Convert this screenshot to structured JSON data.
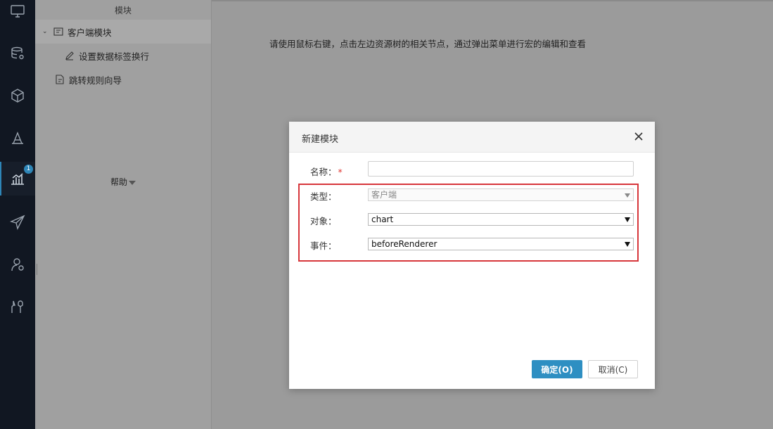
{
  "nav": {
    "items": [
      {
        "icon": "monitor-icon"
      },
      {
        "icon": "database-gear-icon"
      },
      {
        "icon": "cube-icon"
      },
      {
        "icon": "ruler-icon"
      },
      {
        "icon": "bar-chart-icon",
        "badge": "1"
      },
      {
        "icon": "paper-plane-icon"
      },
      {
        "icon": "user-settings-icon"
      },
      {
        "icon": "tools-icon"
      }
    ]
  },
  "tree": {
    "header": "模块",
    "items": [
      {
        "label": "客户端模块"
      },
      {
        "label": "设置数据标签换行"
      },
      {
        "label": "跳转规则向导"
      }
    ],
    "help": "帮助"
  },
  "main": {
    "hint": "请使用鼠标右键，点击左边资源树的相关节点，通过弹出菜单进行宏的编辑和查看"
  },
  "dialog": {
    "title": "新建模块",
    "name_label": "名称：",
    "required_mark": "*",
    "name_value": "",
    "type_label": "类型：",
    "type_value": "客户端",
    "object_label": "对象：",
    "object_value": "chart",
    "event_label": "事件：",
    "event_value": "beforeRenderer",
    "ok_label": "确定(O)",
    "cancel_label": "取消(C)"
  }
}
